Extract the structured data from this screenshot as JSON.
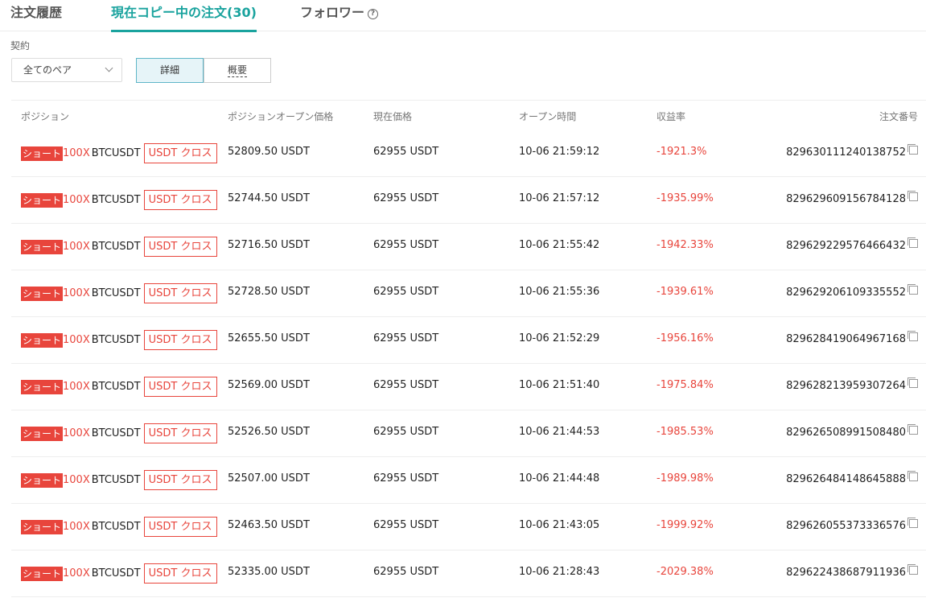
{
  "tabs": [
    {
      "label": "注文履歴"
    },
    {
      "label": "現在コピー中の注文(30)"
    },
    {
      "label": "フォロワー"
    }
  ],
  "help_icon": "?",
  "filter": {
    "contract_label": "契約",
    "pair_selected": "全てのペア"
  },
  "view_toggle": {
    "detail": "詳細",
    "summary": "概要"
  },
  "table": {
    "headers": {
      "position": "ポジション",
      "open_price": "ポジションオープン価格",
      "current_price": "現在価格",
      "open_time": "オープン時間",
      "pnl_rate": "収益率",
      "order_id": "注文番号"
    },
    "rows": [
      {
        "side": "ショート",
        "leverage": "100X",
        "symbol": "BTCUSDT",
        "margin": "USDT クロス",
        "open_price": "52809.50 USDT",
        "current_price": "62955 USDT",
        "open_time": "10-06 21:59:12",
        "pnl": "-1921.3%",
        "order_id": "829630111240138752"
      },
      {
        "side": "ショート",
        "leverage": "100X",
        "symbol": "BTCUSDT",
        "margin": "USDT クロス",
        "open_price": "52744.50 USDT",
        "current_price": "62955 USDT",
        "open_time": "10-06 21:57:12",
        "pnl": "-1935.99%",
        "order_id": "829629609156784128"
      },
      {
        "side": "ショート",
        "leverage": "100X",
        "symbol": "BTCUSDT",
        "margin": "USDT クロス",
        "open_price": "52716.50 USDT",
        "current_price": "62955 USDT",
        "open_time": "10-06 21:55:42",
        "pnl": "-1942.33%",
        "order_id": "829629229576466432"
      },
      {
        "side": "ショート",
        "leverage": "100X",
        "symbol": "BTCUSDT",
        "margin": "USDT クロス",
        "open_price": "52728.50 USDT",
        "current_price": "62955 USDT",
        "open_time": "10-06 21:55:36",
        "pnl": "-1939.61%",
        "order_id": "829629206109335552"
      },
      {
        "side": "ショート",
        "leverage": "100X",
        "symbol": "BTCUSDT",
        "margin": "USDT クロス",
        "open_price": "52655.50 USDT",
        "current_price": "62955 USDT",
        "open_time": "10-06 21:52:29",
        "pnl": "-1956.16%",
        "order_id": "829628419064967168"
      },
      {
        "side": "ショート",
        "leverage": "100X",
        "symbol": "BTCUSDT",
        "margin": "USDT クロス",
        "open_price": "52569.00 USDT",
        "current_price": "62955 USDT",
        "open_time": "10-06 21:51:40",
        "pnl": "-1975.84%",
        "order_id": "829628213959307264"
      },
      {
        "side": "ショート",
        "leverage": "100X",
        "symbol": "BTCUSDT",
        "margin": "USDT クロス",
        "open_price": "52526.50 USDT",
        "current_price": "62955 USDT",
        "open_time": "10-06 21:44:53",
        "pnl": "-1985.53%",
        "order_id": "829626508991508480"
      },
      {
        "side": "ショート",
        "leverage": "100X",
        "symbol": "BTCUSDT",
        "margin": "USDT クロス",
        "open_price": "52507.00 USDT",
        "current_price": "62955 USDT",
        "open_time": "10-06 21:44:48",
        "pnl": "-1989.98%",
        "order_id": "829626484148645888"
      },
      {
        "side": "ショート",
        "leverage": "100X",
        "symbol": "BTCUSDT",
        "margin": "USDT クロス",
        "open_price": "52463.50 USDT",
        "current_price": "62955 USDT",
        "open_time": "10-06 21:43:05",
        "pnl": "-1999.92%",
        "order_id": "829626055373336576"
      },
      {
        "side": "ショート",
        "leverage": "100X",
        "symbol": "BTCUSDT",
        "margin": "USDT クロス",
        "open_price": "52335.00 USDT",
        "current_price": "62955 USDT",
        "open_time": "10-06 21:28:43",
        "pnl": "-2029.38%",
        "order_id": "829622438687911936"
      }
    ]
  },
  "colors": {
    "accent": "#1aa39e",
    "short": "#e8453c",
    "toggle_active_bg": "#e6f4f8"
  }
}
